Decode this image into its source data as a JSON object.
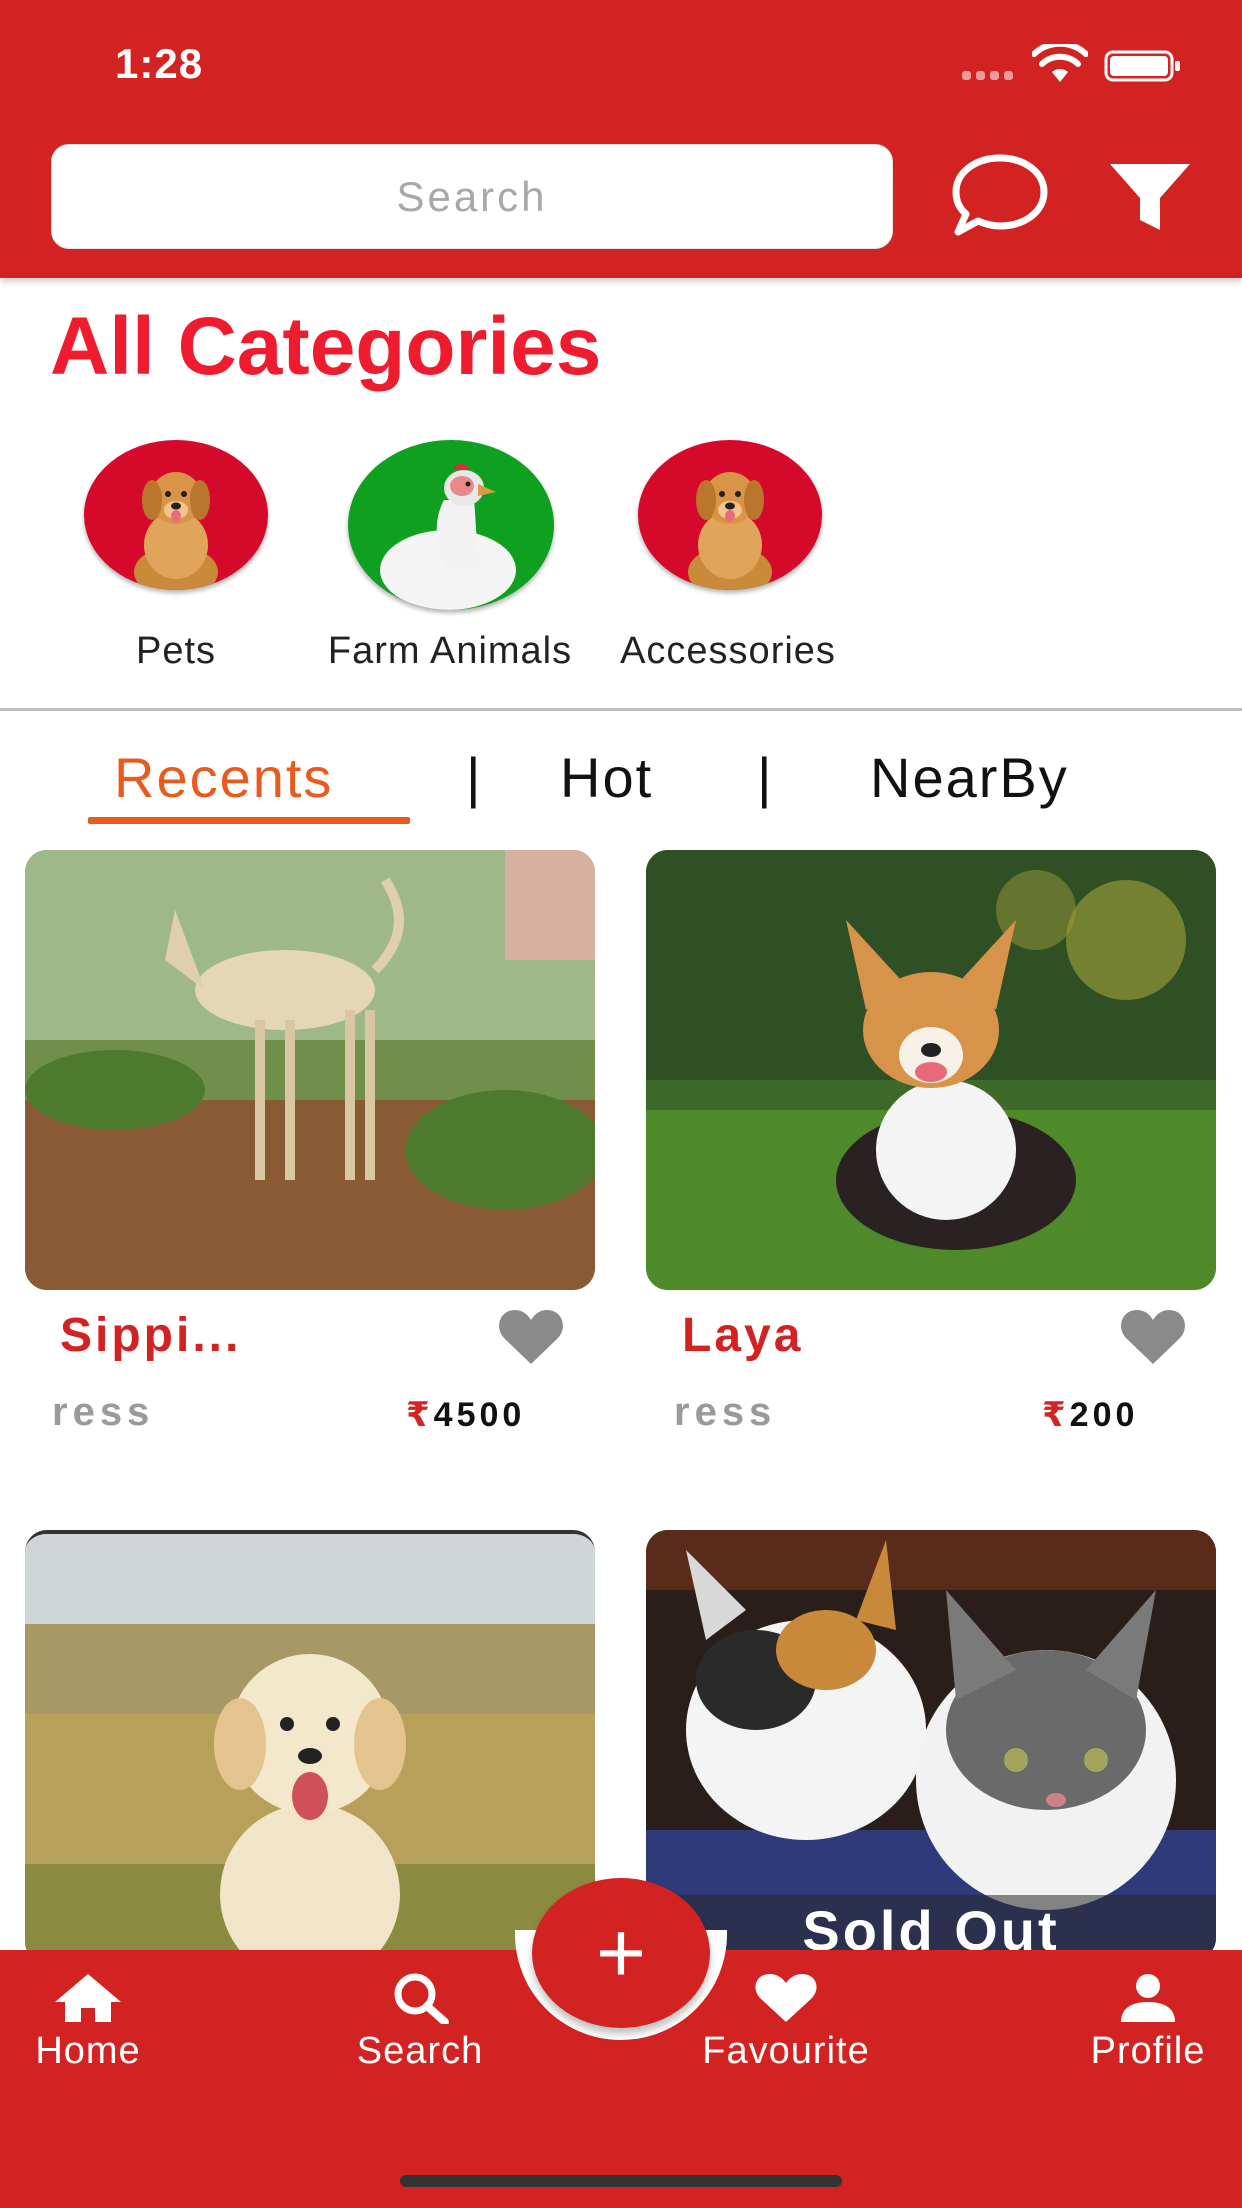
{
  "status_bar": {
    "time": "1:28"
  },
  "header": {
    "search_placeholder": "Search",
    "icons": {
      "chat": "chat-bubble-icon",
      "filter": "filter-icon"
    }
  },
  "categories": {
    "title": "All Categories",
    "items": [
      {
        "label": "Pets",
        "image": "golden-retriever-on-red"
      },
      {
        "label": "Farm Animals",
        "image": "white-hen-on-green"
      },
      {
        "label": "Accessories",
        "image": "golden-retriever-on-red"
      }
    ]
  },
  "tabs": [
    {
      "label": "Recents",
      "active": true
    },
    {
      "label": "Hot",
      "active": false
    },
    {
      "label": "NearBy",
      "active": false
    }
  ],
  "tab_separator": "|",
  "listings": [
    {
      "name": "Sippi...",
      "location": "ress",
      "currency": "₹",
      "price": "4500",
      "image": "tan-sighthound-dog",
      "favourited": false
    },
    {
      "name": "Laya",
      "location": "ress",
      "currency": "₹",
      "price": "200",
      "image": "corgi-puppy-on-grass",
      "favourited": false
    },
    {
      "image": "golden-retriever-puppy"
    },
    {
      "image": "two-kittens",
      "badge": "Sold Out"
    }
  ],
  "fab": {
    "label": "+"
  },
  "bottom_nav": [
    {
      "label": "Home",
      "icon": "home-icon"
    },
    {
      "label": "Search",
      "icon": "search-icon"
    },
    {
      "label": "Favourite",
      "icon": "heart-icon"
    },
    {
      "label": "Profile",
      "icon": "person-icon"
    }
  ],
  "colors": {
    "primary": "#d32222",
    "title_red": "#ee1c2e",
    "tab_active": "#e85a1e",
    "heart_gray": "#8a8a8a"
  }
}
